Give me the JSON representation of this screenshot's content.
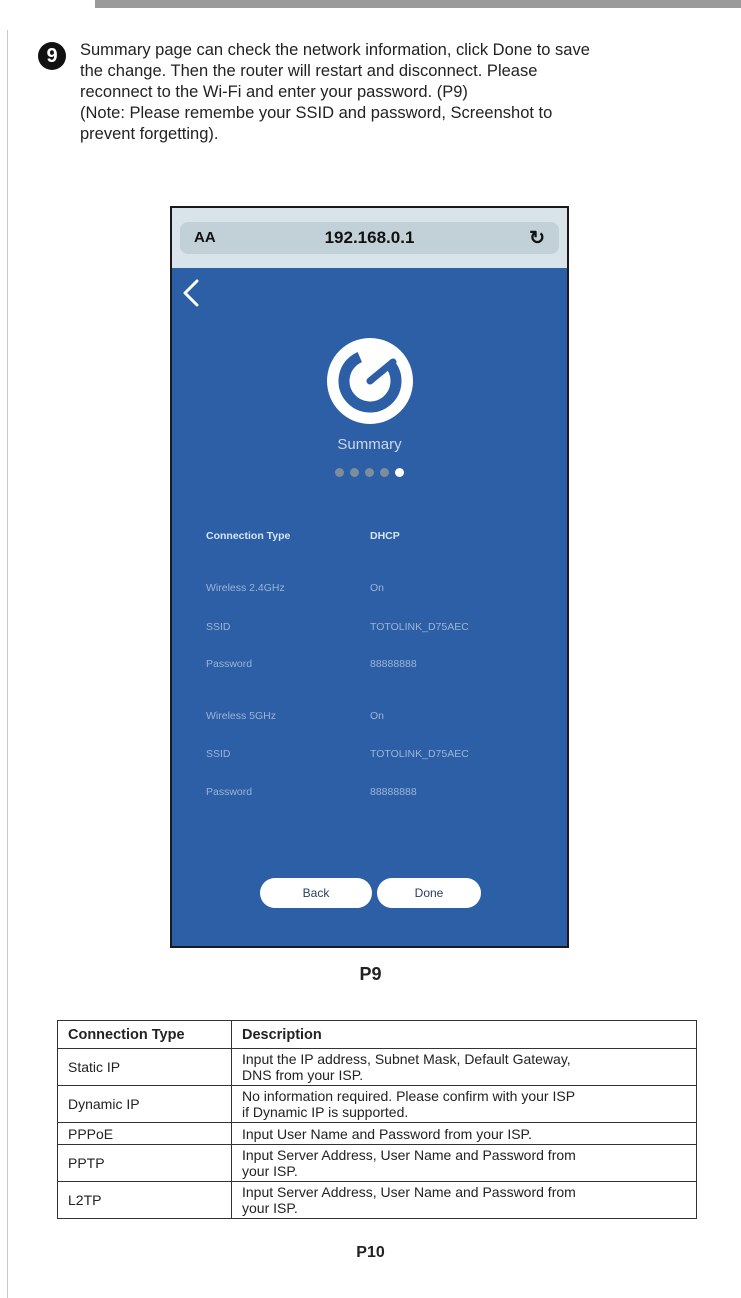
{
  "step": {
    "number": "9",
    "lines": [
      "Summary page can check the network information, click Done to save",
      "the change. Then the router will restart and disconnect. Please",
      "reconnect to the Wi-Fi and enter your password. (P9)",
      "(Note: Please remembe your SSID and password, Screenshot to",
      "prevent forgetting)."
    ]
  },
  "phone": {
    "url_bar": {
      "aa_label": "AA",
      "url": "192.168.0.1",
      "reload_icon": "reload-icon"
    },
    "back_icon": "chevron-left-icon",
    "logo_icon": "brand-logo-icon",
    "title": "Summary",
    "progress": {
      "total_steps": 5,
      "current_step": 5
    },
    "info": [
      {
        "label": "Connection Type",
        "value": "DHCP"
      },
      {
        "label": "Wireless 2.4GHz",
        "value": "On"
      },
      {
        "label": "SSID",
        "value": "TOTOLINK_D75AEC"
      },
      {
        "label": "Password",
        "value": "88888888"
      },
      {
        "label": "Wireless 5GHz",
        "value": "On"
      },
      {
        "label": "SSID",
        "value": "TOTOLINK_D75AEC"
      },
      {
        "label": "Password",
        "value": "88888888"
      }
    ],
    "buttons": {
      "back": "Back",
      "done": "Done"
    },
    "colors": {
      "background": "#2d5fa6",
      "url_bar": "#d9e4ea"
    }
  },
  "caption_p9": "P9",
  "table": {
    "headers": [
      "Connection Type",
      "Description"
    ],
    "rows": [
      {
        "type": "Static IP",
        "desc_lines": [
          "Input the IP address, Subnet Mask, Default Gateway,",
          "DNS from your ISP."
        ]
      },
      {
        "type": "Dynamic IP",
        "desc_lines": [
          "No information required. Please confirm with your ISP",
          "if Dynamic IP is supported."
        ]
      },
      {
        "type": "PPPoE",
        "desc_lines": [
          "Input User Name and Password from your ISP."
        ]
      },
      {
        "type": "PPTP",
        "desc_lines": [
          "Input  Server Address, User Name and Password from",
          "your ISP."
        ]
      },
      {
        "type": "L2TP",
        "desc_lines": [
          "Input  Server Address, User Name and Password from",
          "your ISP."
        ]
      }
    ]
  },
  "caption_p10": "P10"
}
